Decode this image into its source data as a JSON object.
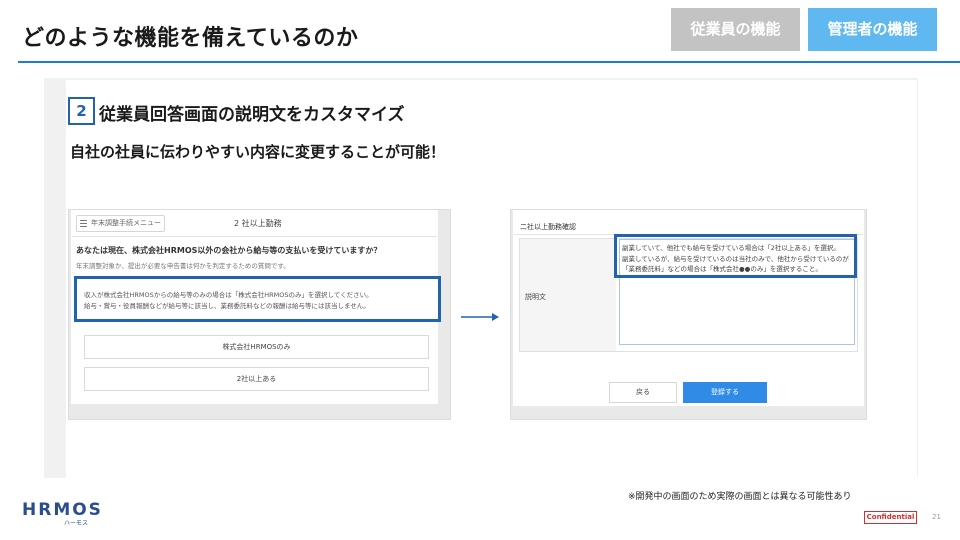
{
  "header": {
    "title": "どのような機能を備えているのか",
    "tabs": [
      {
        "label": "従業員の機能",
        "active": false
      },
      {
        "label": "管理者の機能",
        "active": true
      }
    ],
    "accent_color": "#1d7fd1"
  },
  "section": {
    "number": "2",
    "title": "従業員回答画面の説明文をカスタマイズ",
    "lead": "自社の社員に伝わりやすい内容に変更することが可能！"
  },
  "left_screen": {
    "menu_button": "年末調整手続メニュー",
    "step_label": "2 社以上勤務",
    "question": "あなたは現在、株式会社HRMOS以外の会社から給与等の支払いを受けていますか？",
    "question_sub": "年末調整対象か、提出が必要な申告書は何かを判定するための質問です。",
    "description": "収入が株式会社HRMOSからの給与等のみの場合は「株式会社HRMOSのみ」を選択してください。\n給与・賞与・役員報酬などが給与等に該当し、業務委託料などの報酬は給与等には該当しません。",
    "options": [
      "株式会社HRMOSのみ",
      "2社以上ある"
    ]
  },
  "right_screen": {
    "title": "二社以上勤務確認",
    "field_label": "説明文",
    "description": "副業していて、他社でも給与を受けている場合は「2社以上ある」を選択。\n副業しているが、給与を受けているのは当社のみで、他社から受けているのが\n「業務委託料」などの場合は「株式会社●●のみ」を選択すること。",
    "back_button": "戻る",
    "save_button": "登録する"
  },
  "footer": {
    "note": "※開発中の画面のため実際の画面とは異なる可能性あり",
    "logo": "HRMOS",
    "logo_sub": "ハーモス",
    "confidential": "Confidential",
    "page_number": "21"
  }
}
